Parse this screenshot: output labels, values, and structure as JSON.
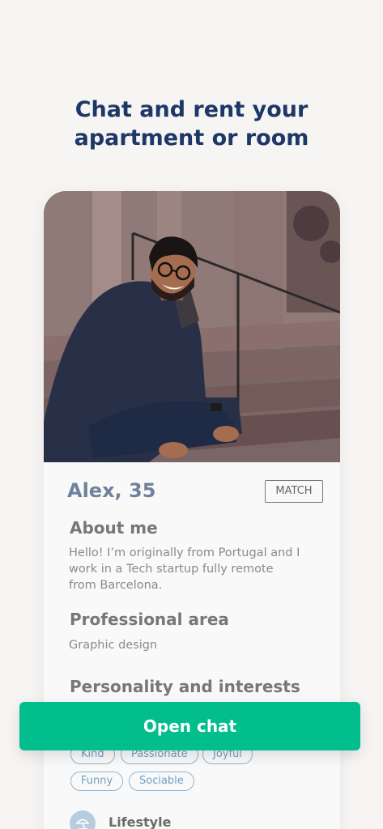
{
  "headline": {
    "line1": "Chat and rent your",
    "line2": "apartment or room"
  },
  "profile": {
    "name_age": "Alex, 35",
    "match_label": "MATCH",
    "about_title": "About me",
    "about_line1": "Hello! I’m originally from Portugal and I",
    "about_line2": "work in a Tech startup fully remote",
    "about_line3": "from Barcelona.",
    "professional_title": "Professional area",
    "professional_value": "Graphic design",
    "personality_title": "Personality and interests",
    "tags": [
      "Kind",
      "Passionate",
      "Joyful",
      "Funny",
      "Sociable"
    ],
    "lifestyle_label": "Lifestyle",
    "lifestyle_icon": "beach-umbrella-icon"
  },
  "cta": {
    "open_chat_label": "Open chat"
  },
  "colors": {
    "background": "#f6f5f4",
    "headline": "#1d3766",
    "accent": "#02bd8c",
    "name": "#6e829c",
    "tag_border": "#8fb5d2"
  }
}
